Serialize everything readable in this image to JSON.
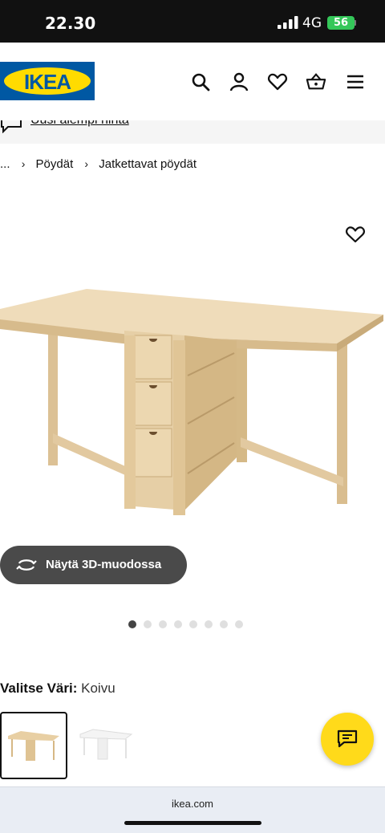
{
  "status_bar": {
    "time": "22.30",
    "network": "4G",
    "battery": "56"
  },
  "header": {
    "logo_text": "IKEA",
    "icons": [
      "search-icon",
      "user-icon",
      "heart-icon",
      "basket-icon",
      "menu-icon"
    ]
  },
  "promo": {
    "link_text": "Uusi alempi hinta",
    "icon": "chat-bubble-icon"
  },
  "breadcrumb": {
    "ellipsis": "...",
    "items": [
      "Pöydät",
      "Jatkettavat pöydät"
    ]
  },
  "product": {
    "image_alt": "Jatkettava pöytä, koivu",
    "favorite_icon": "heart-outline-icon",
    "btn_3d_label": "Näytä 3D-muodossa",
    "gallery": {
      "total": 8,
      "active_index": 0
    }
  },
  "color_selector": {
    "label": "Valitse Väri:",
    "value": "Koivu",
    "swatches": [
      {
        "name": "Koivu",
        "selected": true,
        "wood": "#e8cfa3"
      },
      {
        "name": "Valkoinen",
        "selected": false,
        "wood": "#f4f4f4"
      }
    ]
  },
  "chat_button": {
    "icon": "chat-icon"
  },
  "browser": {
    "url": "ikea.com"
  },
  "colors": {
    "brand_blue": "#0058a3",
    "brand_yellow": "#ffdb00",
    "chat_yellow": "#ffda1a"
  }
}
